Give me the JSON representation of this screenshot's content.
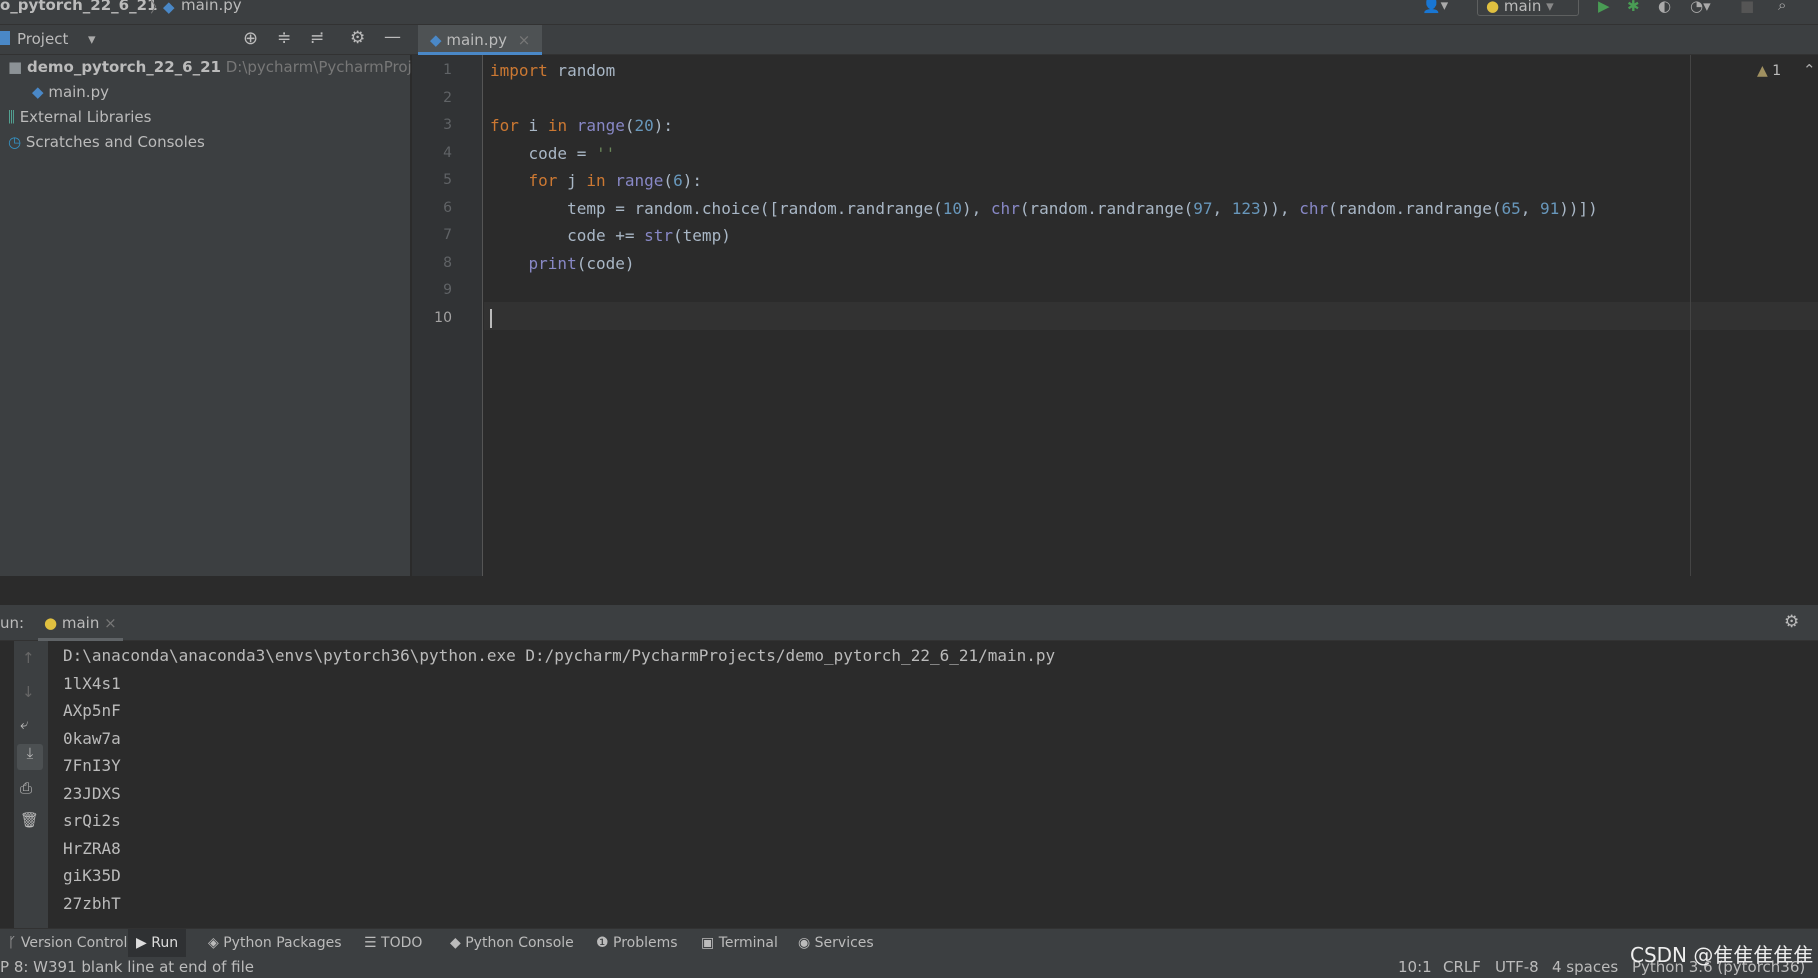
{
  "navbar": {
    "project": "o_pytorch_22_6_21",
    "file": "main.py",
    "run_config": "main"
  },
  "project_panel": {
    "title": "Project",
    "root": "demo_pytorch_22_6_21",
    "root_path": "D:\\pycharm\\PycharmProjec",
    "file": "main.py",
    "libs": "External Libraries",
    "scratches": "Scratches and Consoles"
  },
  "editor": {
    "tab": "main.py",
    "warnings": "1",
    "line_numbers": [
      "1",
      "2",
      "3",
      "4",
      "5",
      "6",
      "7",
      "8",
      "9",
      "10"
    ]
  },
  "run": {
    "label": "un:",
    "tab": "main",
    "command": "D:\\anaconda\\anaconda3\\envs\\pytorch36\\python.exe D:/pycharm/PycharmProjects/demo_pytorch_22_6_21/main.py",
    "output": [
      "1lX4s1",
      "AXp5nF",
      "0kaw7a",
      "7FnI3Y",
      "23JDXS",
      "srQi2s",
      "HrZRA8",
      "giK35D",
      "27zbhT"
    ]
  },
  "toolwindows": [
    "Version Control",
    "Run",
    "Python Packages",
    "TODO",
    "Python Console",
    "Problems",
    "Terminal",
    "Services"
  ],
  "status": {
    "message": "P 8: W391 blank line at end of file",
    "position": "10:1",
    "line_sep": "CRLF",
    "encoding": "UTF-8",
    "indent": "4 spaces",
    "interpreter": "Python 3.6 (pytorch36)",
    "watermark": "CSDN @隹隹隹隹隹"
  },
  "colors": {
    "accent": "#4a88c7",
    "keyword": "#cc7832",
    "number": "#6897bb",
    "builtin": "#8888c6",
    "run_green": "#499c54"
  }
}
